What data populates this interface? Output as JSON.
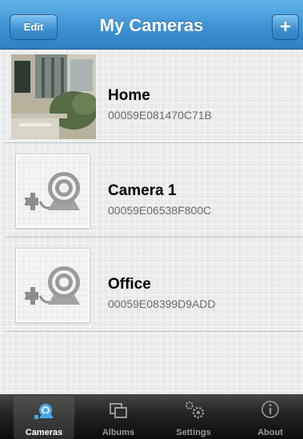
{
  "header": {
    "title": "My Cameras",
    "edit_label": "Edit",
    "add_label": "+"
  },
  "cameras": [
    {
      "name": "Home",
      "id": "00059E081470C71B",
      "thumbnail": "photo"
    },
    {
      "name": "Camera 1",
      "id": "00059E06538F800C",
      "thumbnail": "unplugged-camera-icon"
    },
    {
      "name": "Office",
      "id": "00059E08399D9ADD",
      "thumbnail": "unplugged-camera-icon"
    }
  ],
  "tabbar": {
    "active": "Cameras",
    "tabs": [
      {
        "label": "Cameras",
        "icon": "camera-icon"
      },
      {
        "label": "Albums",
        "icon": "albums-icon"
      },
      {
        "label": "Settings",
        "icon": "gears-icon"
      },
      {
        "label": "About",
        "icon": "info-icon"
      }
    ]
  },
  "colors": {
    "navbar_blue": "#3e92d4",
    "tab_active_blue": "#4aa8e8",
    "list_background": "#e9eaeb"
  }
}
